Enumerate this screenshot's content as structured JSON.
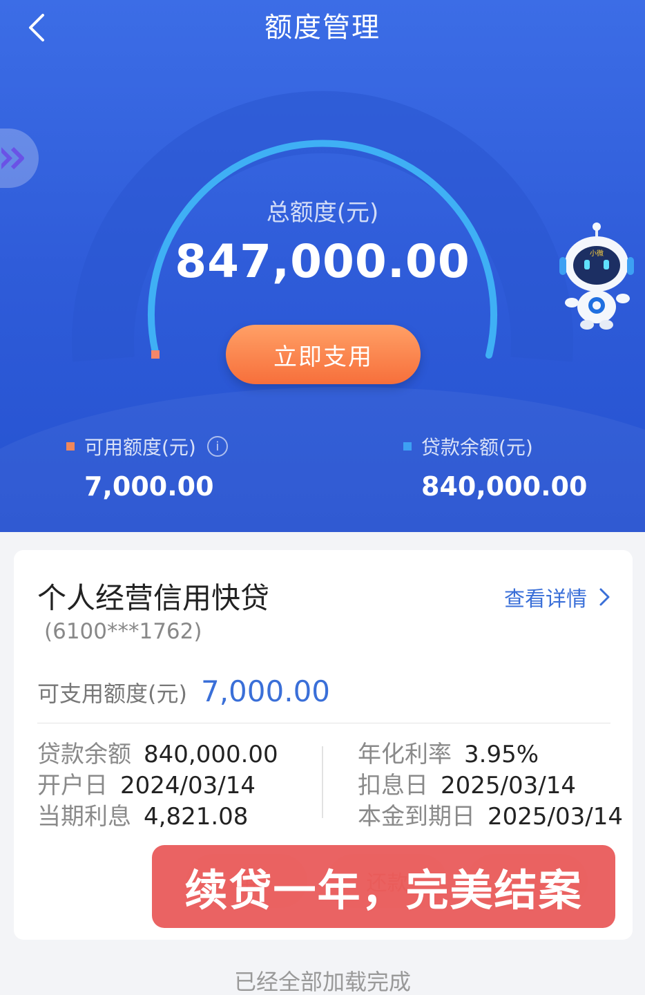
{
  "header": {
    "title": "额度管理",
    "back_icon": "chevron-left-icon"
  },
  "gauge": {
    "total_label": "总额度(元)",
    "total_value": "847,000.00",
    "use_button": "立即支用",
    "used_fraction": 0.992
  },
  "stats": {
    "available_label": "可用额度(元)",
    "available_value": "7,000.00",
    "balance_label": "贷款余额(元)",
    "balance_value": "840,000.00",
    "available_color": "#f0875a",
    "balance_color": "#3da0f3"
  },
  "loan_card": {
    "product_name": "个人经营信用快贷",
    "account": "(6100***1762)",
    "detail_link": "查看详情",
    "available_label": "可支用额度(元)",
    "available_value": "7,000.00",
    "left": [
      {
        "key": "贷款余额",
        "value": "840,000.00"
      },
      {
        "key": "开户日",
        "value": "2024/03/14"
      },
      {
        "key": "当期利息",
        "value": "4,821.08"
      }
    ],
    "right": [
      {
        "key": "年化利率",
        "value": "3.95%"
      },
      {
        "key": "扣息日",
        "value": "2025/03/14"
      },
      {
        "key": "本金到期日",
        "value": "2025/03/14"
      }
    ],
    "ghost_buttons": [
      "用",
      "还款",
      ""
    ]
  },
  "banner": "续贷一年，完美结案",
  "footer": "已经全部加载完成",
  "robot_badge": "小微"
}
